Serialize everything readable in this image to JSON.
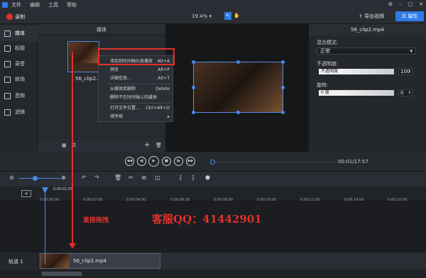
{
  "menubar": {
    "items": [
      "文件",
      "编辑",
      "工具",
      "帮助"
    ]
  },
  "toolbar": {
    "record_label": "录制",
    "zoom": "19.4%",
    "export_label": "导出视频",
    "properties_label": "属性"
  },
  "sidebar": {
    "items": [
      {
        "label": "媒体",
        "icon": "media-icon"
      },
      {
        "label": "标题",
        "icon": "title-icon"
      },
      {
        "label": "录音",
        "icon": "mic-icon"
      },
      {
        "label": "转场",
        "icon": "transition-icon"
      },
      {
        "label": "音频",
        "icon": "audio-icon"
      },
      {
        "label": "滤镜",
        "icon": "filter-icon"
      }
    ]
  },
  "media": {
    "header": "媒体",
    "thumb_label": "56_clip2.mp4"
  },
  "context_menu": {
    "items": [
      {
        "label": "添加到时间轴头部播放",
        "shortcut": "Alt+A"
      },
      {
        "label": "预览",
        "shortcut": "Alt+P"
      },
      {
        "label": "详细信息...",
        "shortcut": "Alt+T"
      },
      {
        "label": "从媒体库删除",
        "shortcut": "Delete"
      },
      {
        "label": "删除不在时间轴上的媒体",
        "shortcut": ""
      },
      {
        "label": "打开文件位置...",
        "shortcut": "Ctrl+Alt+O"
      },
      {
        "label": "排序按",
        "shortcut": ""
      }
    ]
  },
  "right_panel": {
    "title": "56_clip2.mp4",
    "blend_label": "混合模式:",
    "blend_value": "正常",
    "opacity_label": "不透明度:",
    "opacity_field": "不透明度",
    "opacity_value": "100",
    "rotate_label": "旋转:",
    "rotate_field": "0 度",
    "rotate_value": "0"
  },
  "player": {
    "time": "00:01/17:57"
  },
  "timeline": {
    "playhead_time": "0:00:01.05",
    "ticks": [
      "0:00:00.00",
      "0:00:02.00",
      "0:00:04.00",
      "0:00:06.00",
      "0:00:08.00",
      "0:00:10.00",
      "0:00:12.00",
      "0:00:14.00",
      "0:00:16.00"
    ],
    "track_label": "轨道 1",
    "clip_name": "56_clip2.mp4"
  },
  "annotations": {
    "drag_text": "直接拖拽",
    "qq_text": "客服QQ：41442901",
    "color": "#e0302a"
  }
}
